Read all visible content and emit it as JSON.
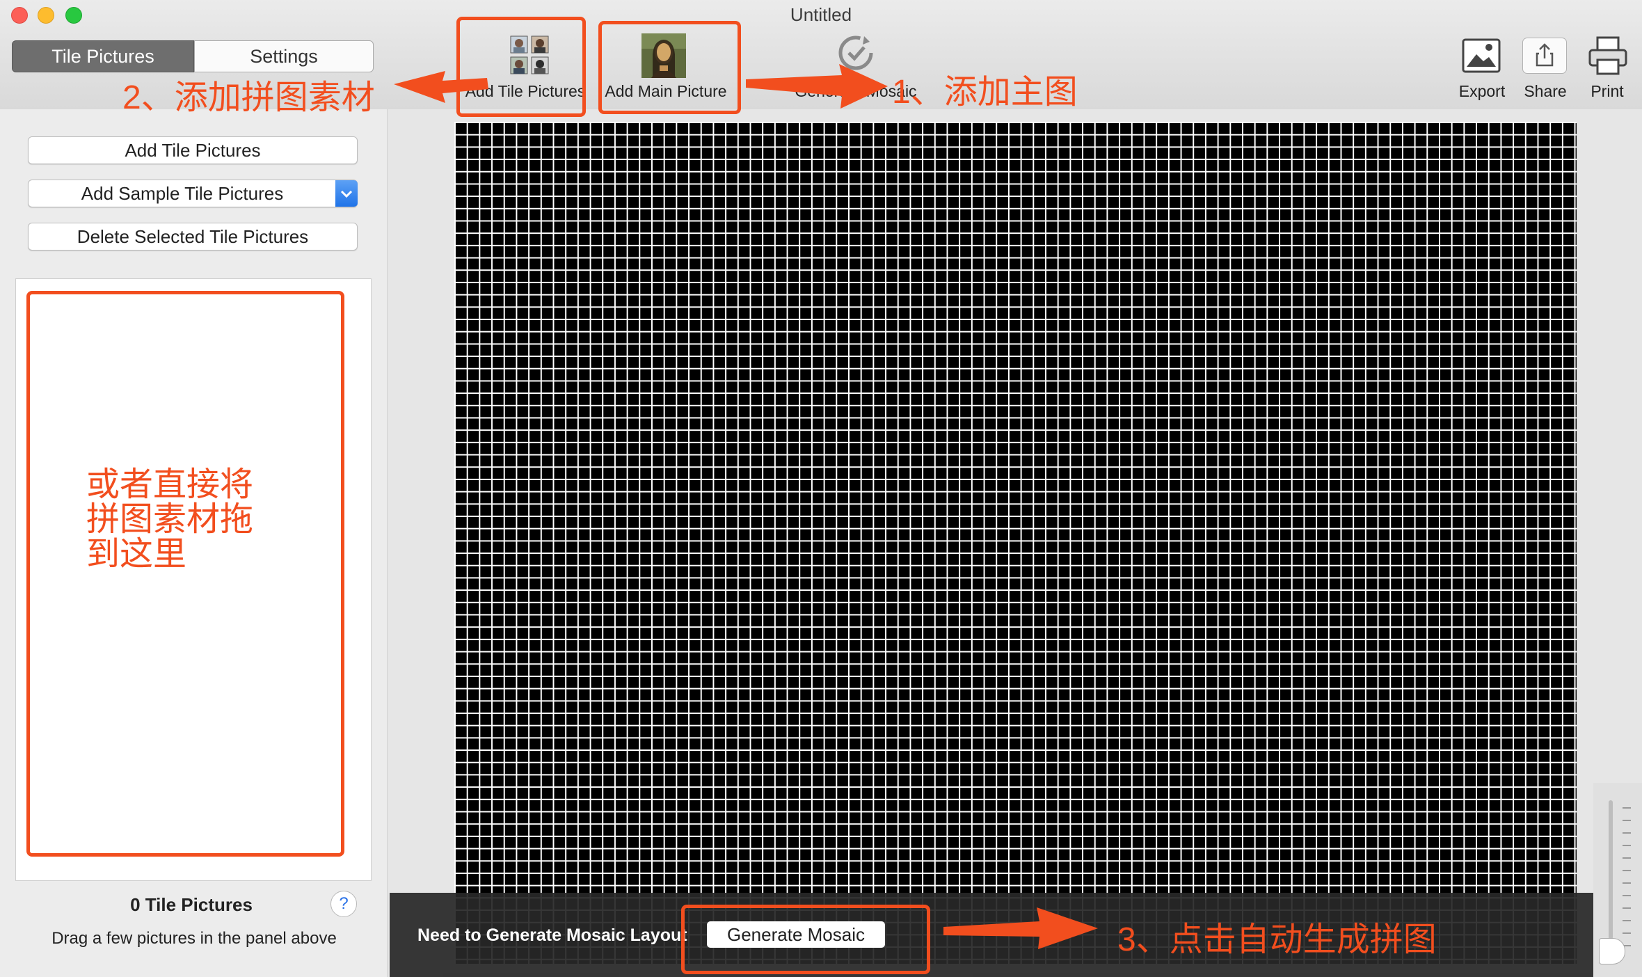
{
  "window": {
    "title": "Untitled",
    "traffic_lights": {
      "close": "#fc5f57",
      "minimize": "#fdbc2e",
      "zoom": "#28c840"
    }
  },
  "segmented": {
    "tab_tiles": "Tile Pictures",
    "tab_settings": "Settings",
    "active": "Tile Pictures"
  },
  "toolbar": {
    "add_tile_pictures": "Add Tile Pictures",
    "add_main_picture": "Add Main Picture",
    "generate_mosaic": "Generate Mosaic",
    "export": "Export",
    "share": "Share",
    "print": "Print"
  },
  "annotations": {
    "step1": "1、添加主图",
    "step2": "2、添加拼图素材",
    "step3": "3、点击自动生成拼图",
    "drop_hint_line1": "或者直接将",
    "drop_hint_line2": "拼图素材拖",
    "drop_hint_line3": "到这里",
    "color": "#f24e1e"
  },
  "sidebar": {
    "add_tile_pictures": "Add Tile Pictures",
    "add_sample_tile_pictures": "Add Sample Tile Pictures",
    "delete_selected": "Delete Selected Tile Pictures",
    "count": "0 Tile Pictures",
    "help": "?",
    "hint": "Drag a few pictures in the panel above"
  },
  "bottom_bar": {
    "message": "Need to Generate Mosaic Layout",
    "button": "Generate Mosaic"
  }
}
